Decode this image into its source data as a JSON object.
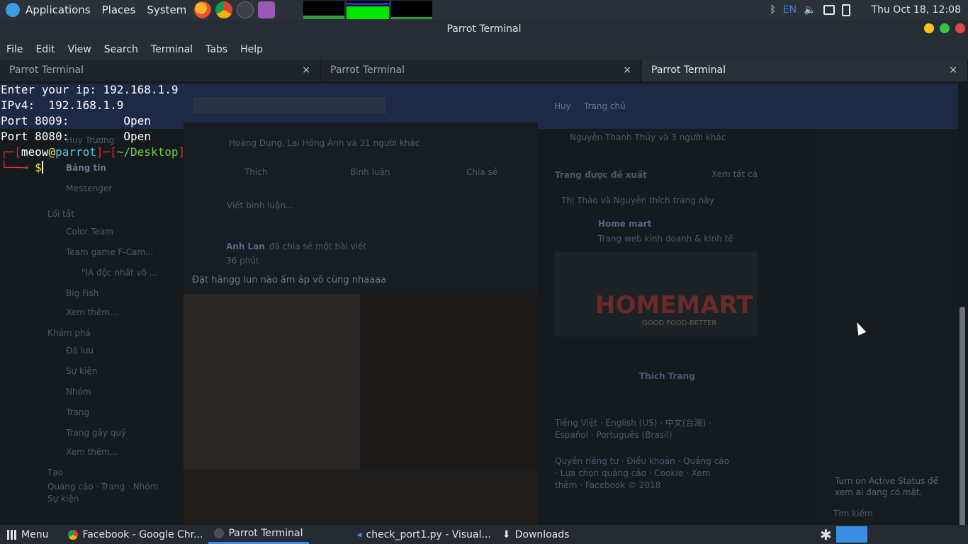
{
  "topbar": {
    "menus": [
      "Applications",
      "Places",
      "System"
    ],
    "language": "EN",
    "clock": "Thu Oct 18, 12:08"
  },
  "window": {
    "title": "Parrot Terminal"
  },
  "menubar": [
    "File",
    "Edit",
    "View",
    "Search",
    "Terminal",
    "Tabs",
    "Help"
  ],
  "tabs": [
    {
      "label": "Parrot Terminal",
      "close": "×"
    },
    {
      "label": "Parrot Terminal",
      "close": "×"
    },
    {
      "label": "Parrot Terminal",
      "close": "×"
    }
  ],
  "terminal": {
    "lines": [
      "Enter your ip: 192.168.1.9",
      "IPv4:  192.168.1.9",
      "Port 8009:        Open",
      "Port 8080:        Open"
    ],
    "prompt": {
      "user": "meow",
      "at": "@",
      "host": "parrot",
      "dir": "~/Desktop",
      "symbol": "$"
    }
  },
  "background_fb": {
    "left_items": [
      "Huy Trương",
      "Bảng tin",
      "Messenger",
      "Lối tắt",
      "Color Team",
      "Team game F-Cam...",
      "\"IA độc nhất vô ...",
      "Big Fish",
      "Xem thêm...",
      "Khám phá",
      "Đã lưu",
      "Sự kiện",
      "Nhóm",
      "Trang",
      "Trang gây quỹ",
      "Xem thêm...",
      "Tạo",
      "Quảng cáo · Trang · Nhóm",
      "Sự kiện"
    ],
    "post_reactions": "Hoàng Dung, Lai Hồng Ánh và 31 người khác",
    "post_actions": [
      "Thích",
      "Bình luận",
      "Chia sẻ"
    ],
    "comment_placeholder": "Viết bình luận...",
    "post_author": "Anh Lan",
    "post_author_action": "đã chia sẻ một bài viết",
    "post_time": "36 phút",
    "post_text": "Đặt hàngg lun nào ấm áp vô cùng nhaaaa",
    "top_nav": [
      "Huy",
      "Trang chủ"
    ],
    "right_liked": "Nguyễn Thanh Thủy và 3 người khác",
    "suggested_title": "Trang được đề xuất",
    "see_all": "Xem tất cả",
    "suggested_sub": "Thị Thảo và Nguyễn thích trang này",
    "suggested_page": "Home mart",
    "suggested_desc": "Trang web kinh doanh & kinh tế",
    "like_page": "Thích Trang",
    "homemart_logo": "HOMEMART",
    "homemart_tag": "GOOD FOOD-BETTER",
    "languages": "Tiếng Việt · English (US) · 中文(台灣) · Español · Português (Brasil)",
    "footer": "Quyền riêng tư · Điều khoản · Quảng cáo · Lựa chọn quảng cáo · Cookie · Xem thêm · Facebook © 2018",
    "chat_status": "Turn on Active Status để xem ai đang có mặt.",
    "chat_search": "Tìm kiếm"
  },
  "taskbar": {
    "menu": "Menu",
    "items": [
      {
        "label": "Facebook - Google Chr...",
        "active": false
      },
      {
        "label": "Parrot Terminal",
        "active": true
      },
      {
        "label": "check_port1.py - Visual...",
        "active": false
      },
      {
        "label": "Downloads",
        "active": false
      }
    ]
  },
  "colors": {
    "prompt_red": "#e1312f",
    "prompt_green": "#6fcf52",
    "prompt_cyan": "#4ec9e7",
    "prompt_yellow": "#e8e84a",
    "close_red": "#e04646",
    "maximize_green": "#3cc23c",
    "minimize_yellow": "#f5c518"
  }
}
